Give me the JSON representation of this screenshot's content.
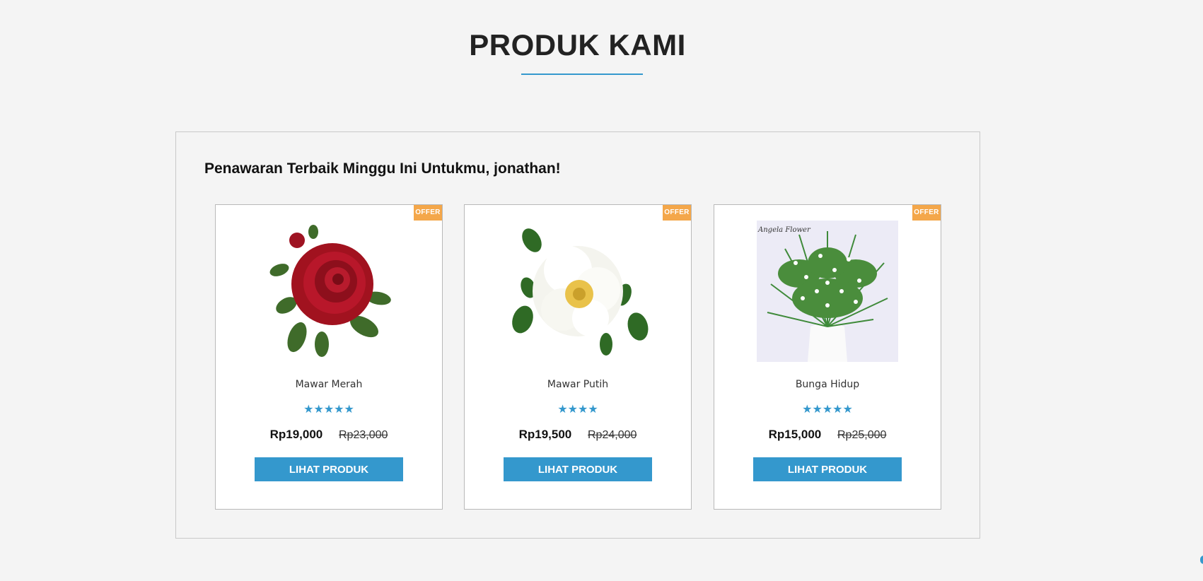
{
  "page": {
    "title": "PRODUK KAMI"
  },
  "colors": {
    "accent": "#3498cd",
    "offer_badge": "#f4a74a",
    "background": "#f4f4f4"
  },
  "offer_section": {
    "heading": "Penawaran Terbaik Minggu Ini Untukmu, jonathan!",
    "products": [
      {
        "badge": "OFFER",
        "image": "red-rose-image",
        "name": "Mawar Merah",
        "rating": 5,
        "stars_text": "★★★★★",
        "price": "Rp19,000",
        "old_price": "Rp23,000",
        "button_label": "LIHAT PRODUK"
      },
      {
        "badge": "OFFER",
        "image": "white-rose-image",
        "name": "Mawar Putih",
        "rating": 4,
        "stars_text": "★★★★",
        "price": "Rp19,500",
        "old_price": "Rp24,000",
        "button_label": "LIHAT PRODUK"
      },
      {
        "badge": "OFFER",
        "image": "live-flower-plant-image",
        "name": "Bunga Hidup",
        "rating": 5,
        "stars_text": "★★★★★",
        "price": "Rp15,000",
        "old_price": "Rp25,000",
        "button_label": "LIHAT PRODUK"
      }
    ]
  }
}
